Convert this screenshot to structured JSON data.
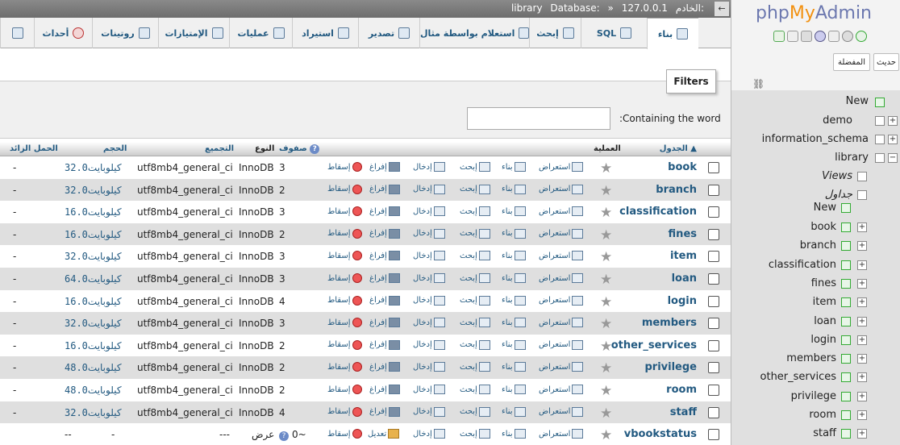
{
  "topbar": {
    "server_label": "الخادم:",
    "server_value": "127.0.0.1",
    "sep": "»",
    "db_label": "Database:",
    "db_value": "library",
    "collapse": "←"
  },
  "tabs": [
    {
      "label": "بناء",
      "icon": "structure-icon"
    },
    {
      "label": "SQL",
      "icon": "sql-icon"
    },
    {
      "label": "إبحث",
      "icon": "search-icon"
    },
    {
      "label": "استعلام بواسطة مثال",
      "icon": "query-icon"
    },
    {
      "label": "تصدير",
      "icon": "export-icon"
    },
    {
      "label": "استيراد",
      "icon": "import-icon"
    },
    {
      "label": "عمليات",
      "icon": "wrench-icon"
    },
    {
      "label": "الإمتيازات",
      "icon": "privileges-icon"
    },
    {
      "label": "روتينات",
      "icon": "routines-icon"
    },
    {
      "label": "أحداث",
      "icon": "events-icon"
    },
    {
      "label": "",
      "icon": "triggers-icon"
    }
  ],
  "filters": {
    "legend": "Filters",
    "label": ":Containing the word",
    "value": ""
  },
  "table": {
    "headers": {
      "table": "الجدول",
      "action": "العملية",
      "rows": "صفوف",
      "type": "النوع",
      "collation": "التجميع",
      "size": "الحجم",
      "overhead": "الحمل الزائد"
    },
    "action_labels": {
      "browse": "استعراض",
      "structure": "بناء",
      "search": "إبحث",
      "insert": "إدخال",
      "empty": "إفراغ",
      "drop": "إسقاط",
      "edit": "تعديل"
    },
    "rows": [
      {
        "name": "book",
        "rows": "3",
        "type": "InnoDB",
        "collation": "utf8mb4_general_ci",
        "size": "32.0",
        "unit": "كيلوبايت",
        "overhead": "-"
      },
      {
        "name": "branch",
        "rows": "2",
        "type": "InnoDB",
        "collation": "utf8mb4_general_ci",
        "size": "32.0",
        "unit": "كيلوبايت",
        "overhead": "-"
      },
      {
        "name": "classification",
        "rows": "3",
        "type": "InnoDB",
        "collation": "utf8mb4_general_ci",
        "size": "16.0",
        "unit": "كيلوبايت",
        "overhead": "-"
      },
      {
        "name": "fines",
        "rows": "2",
        "type": "InnoDB",
        "collation": "utf8mb4_general_ci",
        "size": "16.0",
        "unit": "كيلوبايت",
        "overhead": "-"
      },
      {
        "name": "item",
        "rows": "3",
        "type": "InnoDB",
        "collation": "utf8mb4_general_ci",
        "size": "32.0",
        "unit": "كيلوبايت",
        "overhead": "-"
      },
      {
        "name": "loan",
        "rows": "3",
        "type": "InnoDB",
        "collation": "utf8mb4_general_ci",
        "size": "64.0",
        "unit": "كيلوبايت",
        "overhead": "-"
      },
      {
        "name": "login",
        "rows": "4",
        "type": "InnoDB",
        "collation": "utf8mb4_general_ci",
        "size": "16.0",
        "unit": "كيلوبايت",
        "overhead": "-"
      },
      {
        "name": "members",
        "rows": "3",
        "type": "InnoDB",
        "collation": "utf8mb4_general_ci",
        "size": "32.0",
        "unit": "كيلوبايت",
        "overhead": "-"
      },
      {
        "name": "other_services",
        "rows": "2",
        "type": "InnoDB",
        "collation": "utf8mb4_general_ci",
        "size": "16.0",
        "unit": "كيلوبايت",
        "overhead": "-"
      },
      {
        "name": "privilege",
        "rows": "2",
        "type": "InnoDB",
        "collation": "utf8mb4_general_ci",
        "size": "48.0",
        "unit": "كيلوبايت",
        "overhead": "-"
      },
      {
        "name": "room",
        "rows": "2",
        "type": "InnoDB",
        "collation": "utf8mb4_general_ci",
        "size": "48.0",
        "unit": "كيلوبايت",
        "overhead": "-"
      },
      {
        "name": "staff",
        "rows": "4",
        "type": "InnoDB",
        "collation": "utf8mb4_general_ci",
        "size": "32.0",
        "unit": "كيلوبايت",
        "overhead": "-"
      }
    ],
    "view_row": {
      "name": "vbookstatus",
      "rows": "0~",
      "type": "عرض",
      "collation": "---",
      "size": "-",
      "overhead": "--"
    }
  },
  "nav": {
    "logo_php": "php",
    "logo_my": "My",
    "logo_admin": "Admin",
    "recent_btn": "حديث",
    "favorites_btn": "المفضلة",
    "tree": {
      "new1": "New",
      "demo": "demo",
      "information_schema": "information_schema",
      "library": "library",
      "views": "Views",
      "tables": "جداول",
      "new2": "New",
      "tables_list": [
        "book",
        "branch",
        "classification",
        "fines",
        "item",
        "loan",
        "login",
        "members",
        "other_services",
        "privilege",
        "room",
        "staff"
      ]
    }
  },
  "colors": {
    "link": "#235a81",
    "logo_blue": "#6c78af",
    "logo_orange": "#f29111",
    "row_even": "#dfdfdf"
  }
}
